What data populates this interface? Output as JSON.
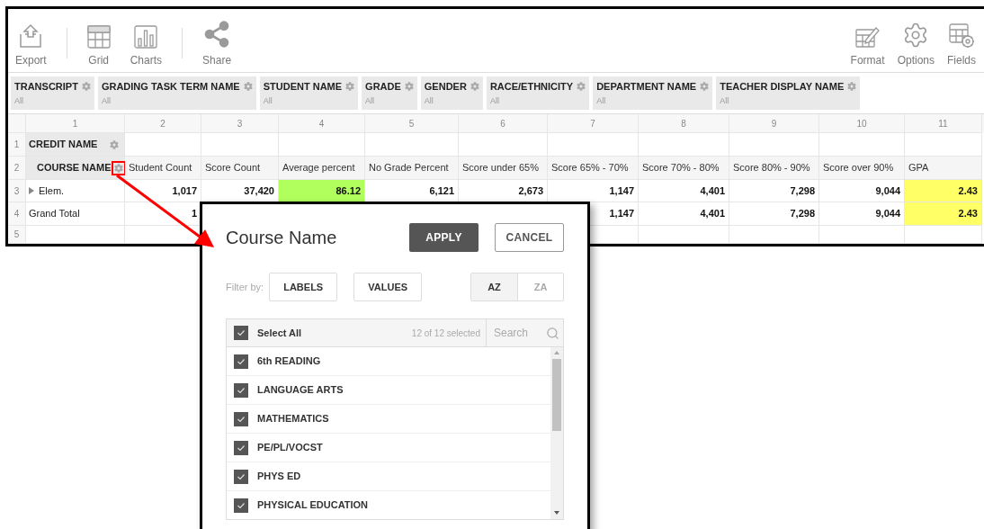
{
  "toolbar": {
    "left_groups": [
      [
        {
          "kind": "export",
          "label": "Export"
        }
      ],
      [
        {
          "kind": "grid",
          "label": "Grid"
        },
        {
          "kind": "charts",
          "label": "Charts"
        }
      ],
      [
        {
          "kind": "share",
          "label": "Share"
        }
      ]
    ],
    "right": [
      {
        "kind": "format",
        "label": "Format"
      },
      {
        "kind": "options",
        "label": "Options"
      },
      {
        "kind": "fields",
        "label": "Fields"
      }
    ]
  },
  "filters": [
    {
      "label": "TRANSCRIPT",
      "value": "All"
    },
    {
      "label": "GRADING TASK TERM NAME",
      "value": "All"
    },
    {
      "label": "STUDENT NAME",
      "value": "All"
    },
    {
      "label": "GRADE",
      "value": "All"
    },
    {
      "label": "GENDER",
      "value": "All"
    },
    {
      "label": "RACE/ETHNICITY",
      "value": "All"
    },
    {
      "label": "DEPARTMENT NAME",
      "value": "All"
    },
    {
      "label": "TEACHER DISPLAY NAME",
      "value": "All"
    }
  ],
  "grid": {
    "column_numbers": [
      "1",
      "2",
      "3",
      "4",
      "5",
      "6",
      "7",
      "8",
      "9",
      "10",
      "11"
    ],
    "rows": [
      {
        "number": "1",
        "kind": "field",
        "header": {
          "label": "CREDIT NAME",
          "highlighted": false
        }
      },
      {
        "number": "2",
        "kind": "labels",
        "header": {
          "label": "COURSE NAME",
          "highlighted": true
        },
        "cells": [
          {
            "value": "Student Count"
          },
          {
            "value": "Score Count"
          },
          {
            "value": "Average percent"
          },
          {
            "value": "No Grade Percent"
          },
          {
            "value": "Score under 65%"
          },
          {
            "value": "Score 65% - 70%"
          },
          {
            "value": "Score 70% - 80%"
          },
          {
            "value": "Score 80% - 90%"
          },
          {
            "value": "Score over 90%"
          },
          {
            "value": "GPA"
          }
        ]
      },
      {
        "number": "3",
        "kind": "data",
        "header": {
          "label": "Elem.",
          "expanded": false
        },
        "cells": [
          {
            "value": "1,017"
          },
          {
            "value": "37,420"
          },
          {
            "value": "86.12",
            "color": "#b0ff5c"
          },
          {
            "value": "6,121"
          },
          {
            "value": "2,673"
          },
          {
            "value": "1,147"
          },
          {
            "value": "4,401"
          },
          {
            "value": "7,298"
          },
          {
            "value": "9,044"
          },
          {
            "value": "2.43",
            "color": "#ffff66"
          }
        ]
      },
      {
        "number": "4",
        "kind": "data",
        "header": {
          "label": "Grand Total"
        },
        "cells": [
          {
            "value": "1"
          },
          null,
          null,
          null,
          null,
          {
            "value": "1,147"
          },
          {
            "value": "4,401"
          },
          {
            "value": "7,298"
          },
          {
            "value": "9,044"
          },
          {
            "value": "2.43",
            "color": "#ffff66"
          }
        ]
      },
      {
        "number": "5",
        "kind": "empty"
      }
    ]
  },
  "popup": {
    "title": "Course Name",
    "apply": "APPLY",
    "cancel": "CANCEL",
    "filter_by": "Filter by:",
    "filter_buttons": [
      "LABELS",
      "VALUES"
    ],
    "sort": [
      {
        "label": "AZ",
        "selected": true
      },
      {
        "label": "ZA",
        "selected": false
      }
    ],
    "select_all": {
      "label": "Select All",
      "checked": true
    },
    "count": "12 of 12 selected",
    "search": {
      "placeholder": "Search"
    },
    "items": [
      {
        "label": "6th READING",
        "checked": true
      },
      {
        "label": "LANGUAGE ARTS",
        "checked": true
      },
      {
        "label": "MATHEMATICS",
        "checked": true
      },
      {
        "label": "PE/PL/VOCST",
        "checked": true
      },
      {
        "label": "PHYS ED",
        "checked": true
      },
      {
        "label": "PHYSICAL EDUCATION",
        "checked": true
      }
    ]
  }
}
